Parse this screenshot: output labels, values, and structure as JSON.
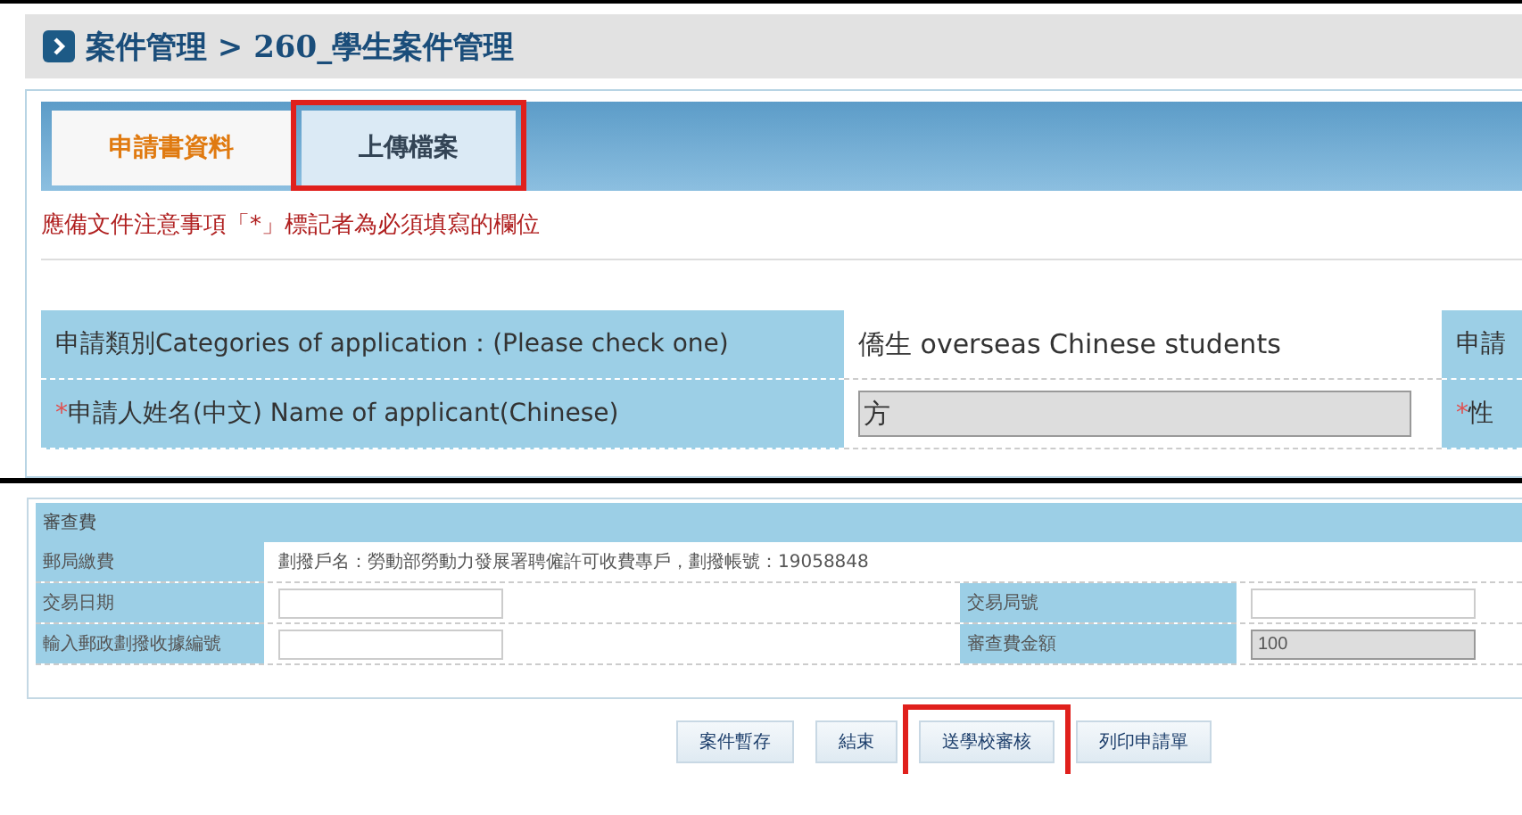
{
  "breadcrumb": "案件管理 > 260_學生案件管理",
  "tabs": [
    {
      "label": "申請書資料",
      "selected": true,
      "highlighted": false
    },
    {
      "label": "上傳檔案",
      "selected": false,
      "highlighted": true
    }
  ],
  "notice": "應備文件注意事項「*」標記者為必須填寫的欄位",
  "form_rows": [
    {
      "label": "申請類別Categories of application：(Please check one)",
      "kind": "text",
      "value": "僑生 overseas Chinese students",
      "next_label": "申請"
    },
    {
      "label": "申請人姓名(中文) Name of applicant(Chinese)",
      "required_mark": "*",
      "kind": "input",
      "value": "方",
      "next_label": "性",
      "next_required_mark": "*"
    }
  ],
  "fee_section": {
    "title": "審查費",
    "rows": [
      {
        "label": "郵局繳費",
        "kind": "text",
        "value": "劃撥戶名：勞動部勞動力發展署聘僱許可收費專戶，劃撥帳號：19058848"
      },
      {
        "label": "交易日期",
        "kind": "pair",
        "value": "",
        "label_2": "交易局號",
        "value_2": "",
        "readonly_2": false
      },
      {
        "label": "輸入郵政劃撥收據編號",
        "kind": "pair",
        "value": "",
        "label_2": "審查費金額",
        "value_2": "100",
        "readonly_2": true
      }
    ]
  },
  "buttons": [
    {
      "label": "案件暫存",
      "highlighted": false
    },
    {
      "label": "結束",
      "highlighted": false
    },
    {
      "label": "送學校審核",
      "highlighted": true
    },
    {
      "label": "列印申請單",
      "highlighted": false
    }
  ]
}
